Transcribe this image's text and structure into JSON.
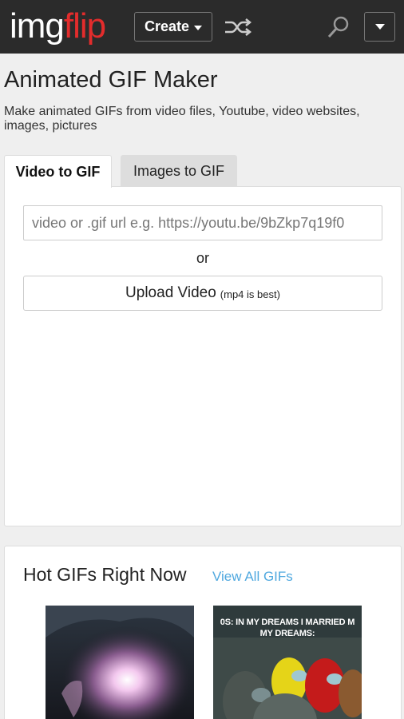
{
  "header": {
    "logo_main": "img",
    "logo_accent": "flip",
    "create_label": "Create",
    "logo_color": "#e32c2c"
  },
  "page": {
    "title": "Animated GIF Maker",
    "subtitle": "Make animated GIFs from video files, Youtube, video websites, images, pictures"
  },
  "tabs": [
    {
      "label": "Video to GIF",
      "active": true
    },
    {
      "label": "Images to GIF",
      "active": false
    }
  ],
  "video_panel": {
    "url_placeholder": "video or .gif url e.g. https://youtu.be/9bZkp7q19f0",
    "or_label": "or",
    "upload_label": "Upload Video",
    "upload_hint": "(mp4 is best)"
  },
  "hot_gifs": {
    "title": "Hot GIFs Right Now",
    "view_all": "View All GIFs",
    "link_color": "#4fa8df",
    "items": [
      {
        "caption": ""
      },
      {
        "caption": "0S: IN MY DREAMS I MARRIED M\nMY DREAMS:"
      }
    ]
  }
}
